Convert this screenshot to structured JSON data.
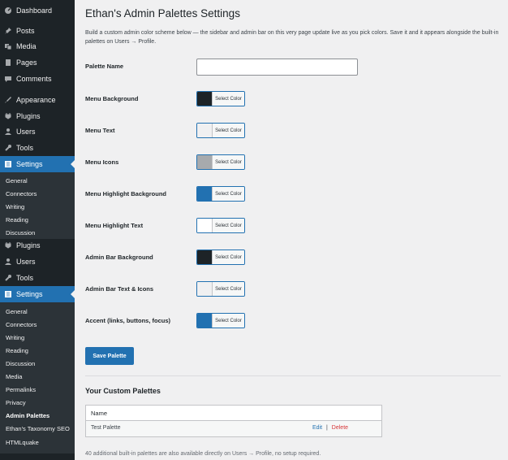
{
  "sidebar": {
    "top_items": [
      {
        "label": "Dashboard",
        "icon": "dashboard-icon"
      },
      {
        "label": "Posts",
        "icon": "pin-icon"
      },
      {
        "label": "Media",
        "icon": "media-icon"
      },
      {
        "label": "Pages",
        "icon": "page-icon"
      },
      {
        "label": "Comments",
        "icon": "comment-icon"
      },
      {
        "label": "Appearance",
        "icon": "brush-icon"
      },
      {
        "label": "Plugins",
        "icon": "plug-icon"
      },
      {
        "label": "Users",
        "icon": "user-icon"
      },
      {
        "label": "Tools",
        "icon": "wrench-icon"
      },
      {
        "label": "Settings",
        "icon": "settings-icon"
      }
    ],
    "submenu_1": [
      "General",
      "Connectors",
      "Writing",
      "Reading",
      "Discussion"
    ],
    "dup_items": [
      {
        "label": "Plugins",
        "icon": "plug-icon"
      },
      {
        "label": "Users",
        "icon": "user-icon"
      },
      {
        "label": "Tools",
        "icon": "wrench-icon"
      },
      {
        "label": "Settings",
        "icon": "settings-icon"
      }
    ],
    "submenu_2": [
      "General",
      "Connectors",
      "Writing",
      "Reading",
      "Discussion",
      "Media",
      "Permalinks",
      "Privacy",
      "Admin Palettes",
      "Ethan's Taxonomy SEO",
      "HTMLquake"
    ]
  },
  "main": {
    "title": "Ethan's Admin Palettes Settings",
    "description": "Build a custom admin color scheme below — the sidebar and admin bar on this very page update live as you pick colors. Save it and it appears alongside the built-in palettes on Users → Profile.",
    "palette_name_label": "Palette Name",
    "palette_name_value": "",
    "select_color_label": "Select Color",
    "color_rows": [
      {
        "label": "Menu Background",
        "color": "#1d2327"
      },
      {
        "label": "Menu Text",
        "color": "#f0f0f1"
      },
      {
        "label": "Menu Icons",
        "color": "#a7aaad"
      },
      {
        "label": "Menu Highlight Background",
        "color": "#2271b1"
      },
      {
        "label": "Menu Highlight Text",
        "color": "#ffffff"
      },
      {
        "label": "Admin Bar Background",
        "color": "#1d2327"
      },
      {
        "label": "Admin Bar Text & Icons",
        "color": "#f0f0f1"
      },
      {
        "label": "Accent (links, buttons, focus)",
        "color": "#2271b1"
      }
    ],
    "save_button": "Save Palette",
    "custom_palettes_heading": "Your Custom Palettes",
    "table": {
      "header": "Name",
      "rows": [
        {
          "name": "Test Palette",
          "edit": "Edit",
          "sep": "|",
          "delete": "Delete"
        }
      ]
    },
    "footer_note": "40 additional built-in palettes are also available directly on Users → Profile, no setup required."
  },
  "colors": {
    "sidebar_bg": "#1d2327",
    "submenu_bg": "#2c3338",
    "highlight": "#2271b1",
    "page_bg": "#f0f0f1",
    "delete": "#d63638"
  }
}
